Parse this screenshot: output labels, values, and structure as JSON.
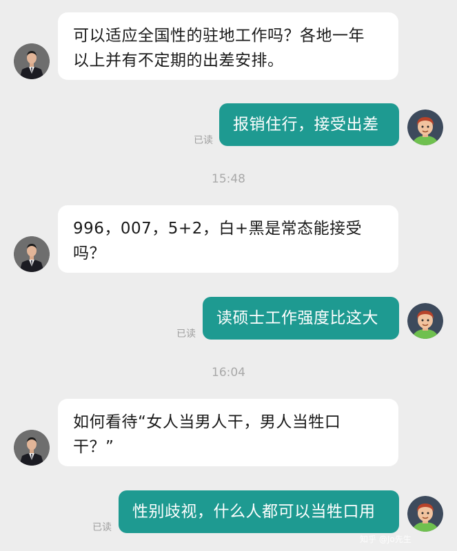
{
  "messages": [
    {
      "id": "m1",
      "sender": "interviewer",
      "lines": [
        "可以适应全国性的驻地工作吗？各地一年",
        "以上并有不定期的出差安排。"
      ]
    },
    {
      "id": "m2",
      "sender": "me",
      "text": "报销住行，接受出差",
      "status": "已读"
    },
    {
      "id": "m3",
      "sender": "interviewer",
      "lines": [
        "996，007，5+2，白+黑是常态能接受",
        "吗？"
      ]
    },
    {
      "id": "m4",
      "sender": "me",
      "text": "读硕士工作强度比这大",
      "status": "已读"
    },
    {
      "id": "m5",
      "sender": "interviewer",
      "lines": [
        "如何看待“女人当男人干，男人当牲口",
        "干？”"
      ]
    },
    {
      "id": "m6",
      "sender": "me",
      "text": "性别歧视，什么人都可以当牲口用",
      "status": "已读"
    }
  ],
  "timestamps": [
    "15:48",
    "16:04"
  ],
  "watermark": "知乎 @Jo先生",
  "colors": {
    "background": "#ededed",
    "outgoing_bubble": "#1e9a91",
    "incoming_bubble": "#ffffff",
    "read_status": "#9e9e9e"
  },
  "icons": {
    "interviewer_avatar": "man-in-suit-avatar-icon",
    "me_avatar": "cartoon-man-avatar-icon"
  }
}
